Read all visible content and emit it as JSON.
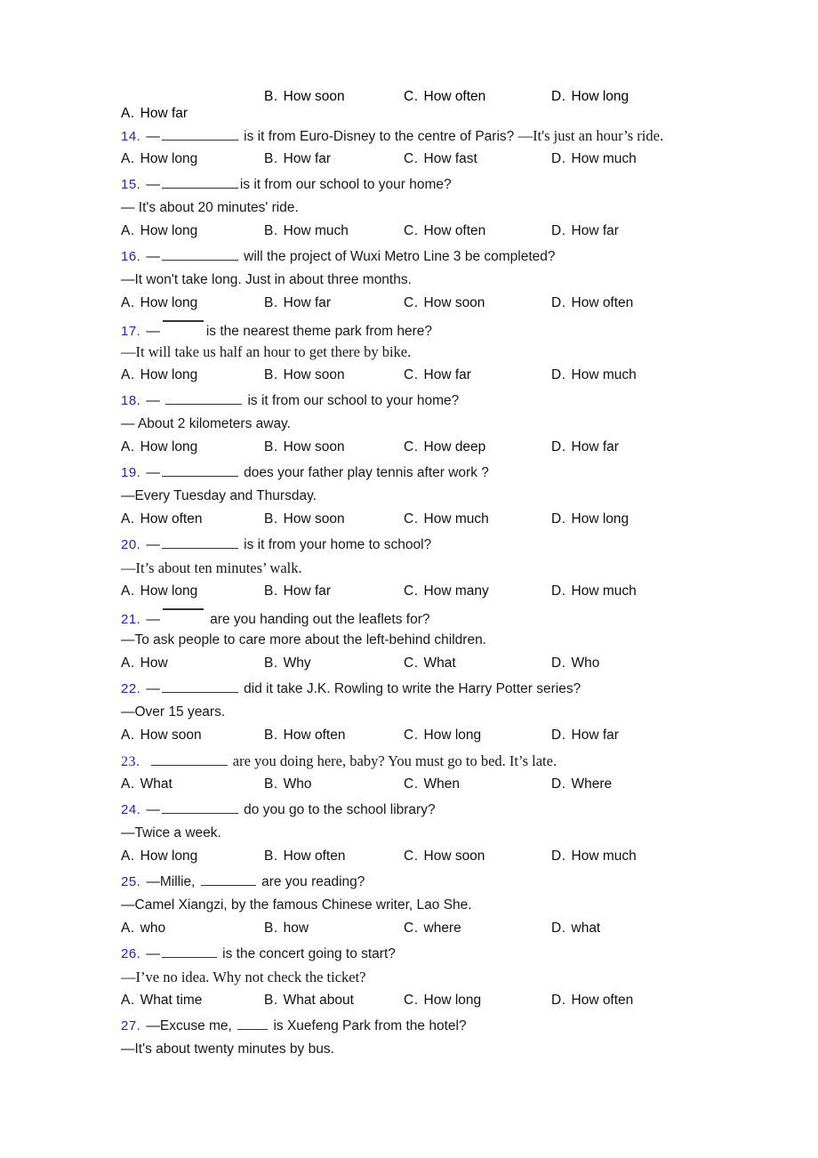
{
  "document": {
    "type": "english-grammar-worksheet",
    "number_color": "#2222cc",
    "text_color": "#1a1a1a"
  },
  "top_partial_options": {
    "a": {
      "label": "A.",
      "text": "How far"
    },
    "b": {
      "label": "B.",
      "text": "How soon"
    },
    "c": {
      "label": "C.",
      "text": "How often"
    },
    "d": {
      "label": "D.",
      "text": "How long"
    }
  },
  "questions": [
    {
      "number": "14.",
      "stem_pre": "—",
      "blank": "long",
      "stem_post": " is it from Euro-Disney to the centre of Paris? ",
      "stem_tail": "—It's just an hour’s ride.",
      "reply": null,
      "options": [
        {
          "label": "A.",
          "text": "How long"
        },
        {
          "label": "B.",
          "text": "How far"
        },
        {
          "label": "C.",
          "text": "How fast"
        },
        {
          "label": "D.",
          "text": "How much"
        }
      ]
    },
    {
      "number": "15.",
      "stem_pre": "—",
      "blank": "long",
      "stem_post": "is it from our school to your home?",
      "reply": "— It's about 20 minutes' ride.",
      "options": [
        {
          "label": "A.",
          "text": "How long"
        },
        {
          "label": "B.",
          "text": "How much"
        },
        {
          "label": "C.",
          "text": "How often"
        },
        {
          "label": "D.",
          "text": "How far"
        }
      ]
    },
    {
      "number": "16.",
      "stem_pre": "—",
      "blank": "long",
      "stem_post": " will the project of Wuxi Metro Line 3 be completed?",
      "reply": "—It won't take long. Just in about three months.",
      "options": [
        {
          "label": "A.",
          "text": "How long"
        },
        {
          "label": "B.",
          "text": "How far"
        },
        {
          "label": "C.",
          "text": "How soon"
        },
        {
          "label": "D.",
          "text": "How often"
        }
      ]
    },
    {
      "number": "17.",
      "stem_pre": "—",
      "blank": "overline",
      "stem_post": "is the nearest theme park from here?",
      "reply": " —It will take us half an hour to get there by bike.",
      "reply_serif": true,
      "options": [
        {
          "label": "A.",
          "text": "How long"
        },
        {
          "label": "B.",
          "text": "How soon"
        },
        {
          "label": "C.",
          "text": "How far"
        },
        {
          "label": "D.",
          "text": "How much"
        }
      ]
    },
    {
      "number": "18.",
      "stem_pre": "— ",
      "blank": "long",
      "stem_post": " is it from our school to your home?",
      "reply": "— About 2 kilometers away.",
      "options": [
        {
          "label": "A.",
          "text": "How long"
        },
        {
          "label": "B.",
          "text": "How soon"
        },
        {
          "label": "C.",
          "text": "How deep"
        },
        {
          "label": "D.",
          "text": "How far"
        }
      ]
    },
    {
      "number": "19.",
      "stem_pre": "—",
      "blank": "long",
      "stem_post": " does your father play tennis after work ?",
      "reply": "—Every Tuesday and Thursday.",
      "options": [
        {
          "label": "A.",
          "text": "How often"
        },
        {
          "label": "B.",
          "text": "How soon"
        },
        {
          "label": "C.",
          "text": "How much"
        },
        {
          "label": "D.",
          "text": "How long"
        }
      ]
    },
    {
      "number": "20.",
      "stem_pre": "—",
      "blank": "long",
      "stem_post": " is it from your home to school?",
      "reply": "—It’s about ten minutes’ walk.",
      "reply_serif": true,
      "options": [
        {
          "label": "A.",
          "text": "How long"
        },
        {
          "label": "B.",
          "text": "How far"
        },
        {
          "label": "C.",
          "text": "How many"
        },
        {
          "label": "D.",
          "text": "How much"
        }
      ]
    },
    {
      "number": "21.",
      "stem_pre": "—",
      "blank": "overline",
      "stem_post": " are you handing out the leaflets for?",
      "reply": "—To ask people to care more about the left-behind children.",
      "options": [
        {
          "label": "A.",
          "text": "How"
        },
        {
          "label": "B.",
          "text": "Why"
        },
        {
          "label": "C.",
          "text": "What"
        },
        {
          "label": "D.",
          "text": "Who"
        }
      ]
    },
    {
      "number": "22.",
      "stem_pre": "—",
      "blank": "long",
      "stem_post": " did it take J.K. Rowling to write the Harry Potter series?",
      "reply": "—Over 15 years.",
      "options": [
        {
          "label": "A.",
          "text": "How soon"
        },
        {
          "label": "B.",
          "text": "How often"
        },
        {
          "label": "C.",
          "text": "How long"
        },
        {
          "label": "D.",
          "text": "How far"
        }
      ]
    },
    {
      "number": "23.",
      "stem_pre": " ",
      "blank": "long",
      "stem_post": " are you doing here, baby? You must go to bed. It’s late.",
      "stem_serif": true,
      "reply": null,
      "options": [
        {
          "label": "A.",
          "text": "What"
        },
        {
          "label": "B.",
          "text": "Who"
        },
        {
          "label": "C.",
          "text": "When"
        },
        {
          "label": "D.",
          "text": "Where"
        }
      ]
    },
    {
      "number": "24.",
      "stem_pre": "—",
      "blank": "long",
      "stem_post": " do you go to the school library?",
      "reply": "—Twice a week.",
      "options": [
        {
          "label": "A.",
          "text": "How long"
        },
        {
          "label": "B.",
          "text": "How often"
        },
        {
          "label": "C.",
          "text": "How soon"
        },
        {
          "label": "D.",
          "text": "How much"
        }
      ]
    },
    {
      "number": "25.",
      "stem_pre": "—Millie, ",
      "blank": "med",
      "stem_post": " are you reading?",
      "reply": "—Camel Xiangzi, by the famous Chinese writer, Lao She.",
      "options": [
        {
          "label": "A.",
          "text": "who"
        },
        {
          "label": "B.",
          "text": "how"
        },
        {
          "label": "C.",
          "text": "where"
        },
        {
          "label": "D.",
          "text": "what"
        }
      ]
    },
    {
      "number": "26.",
      "stem_pre": "—",
      "blank": "med",
      "stem_post": " is the concert going to start?",
      "reply": "—I’ve no idea. Why not check the ticket?",
      "reply_serif": true,
      "options": [
        {
          "label": "A.",
          "text": "What time"
        },
        {
          "label": "B.",
          "text": "What about"
        },
        {
          "label": "C.",
          "text": "How long"
        },
        {
          "label": "D.",
          "text": "How often"
        }
      ]
    },
    {
      "number": "27.",
      "stem_pre": "—Excuse me, ",
      "blank": "short",
      "stem_post": " is Xuefeng Park from the hotel?",
      "reply": "—It's about twenty minutes by bus.",
      "options": []
    }
  ]
}
